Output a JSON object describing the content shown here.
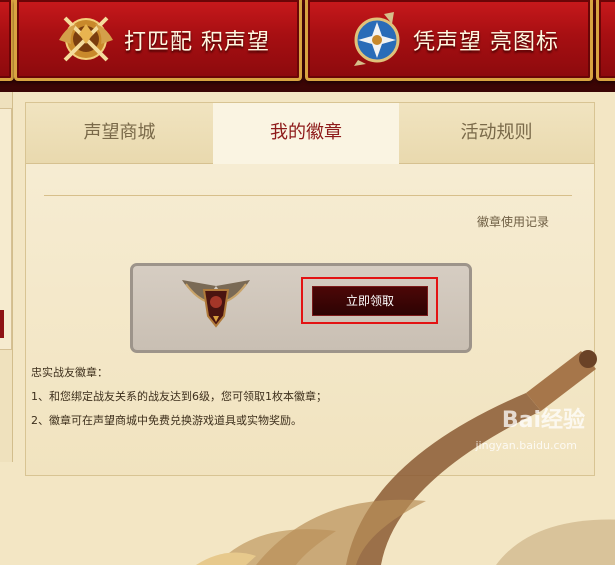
{
  "banner": {
    "match_button_label": "打匹配 积声望",
    "icon_button_label": "凭声望 亮图标"
  },
  "tabs": [
    {
      "label": "声望商城"
    },
    {
      "label": "我的徽章"
    },
    {
      "label": "活动规则"
    }
  ],
  "badge_record_link": "徽章使用记录",
  "claim_button_label": "立即领取",
  "info": {
    "title": "忠实战友徽章：",
    "line1": "1、和您绑定战友关系的战友达到6级，您可领取1枚本徽章；",
    "line2": "2、徽章可在声望商城中免费兑换游戏道具或实物奖励。"
  },
  "watermark": {
    "brand": "Bai经验",
    "url": "jingyan.baidu.com"
  },
  "colors": {
    "banner_red": "#a70f12",
    "banner_border_gold": "#d9a441",
    "active_tab_text": "#8e1a1a",
    "claim_button_bg": "#2d0303",
    "highlight_outline": "#e31313"
  }
}
